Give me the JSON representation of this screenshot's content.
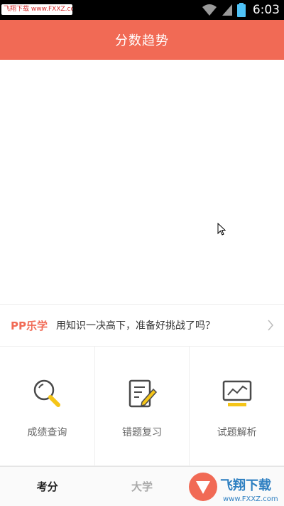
{
  "status_bar": {
    "watermark_text": "飞翔下载 www.FXXZ.com",
    "time": "6:03",
    "icons": [
      "wifi-icon",
      "signal-icon",
      "battery-icon"
    ]
  },
  "header": {
    "title": "分数趋势"
  },
  "promo": {
    "brand": "PP乐学",
    "text": "用知识一决高下，准备好挑战了吗？"
  },
  "features": [
    {
      "label": "成绩查询",
      "icon": "magnifier-icon"
    },
    {
      "label": "错题复习",
      "icon": "notepad-pencil-icon"
    },
    {
      "label": "试题解析",
      "icon": "monitor-chart-icon"
    }
  ],
  "bottom_nav": {
    "items": [
      {
        "label": "考分",
        "active": true
      },
      {
        "label": "大学",
        "active": false
      }
    ]
  },
  "watermark_logo": {
    "text": "飞翔下载",
    "url": "www.FXXZ.com"
  },
  "colors": {
    "accent": "#f16a55",
    "icon_yellow": "#f5c518",
    "icon_dark": "#4a4a4a"
  }
}
